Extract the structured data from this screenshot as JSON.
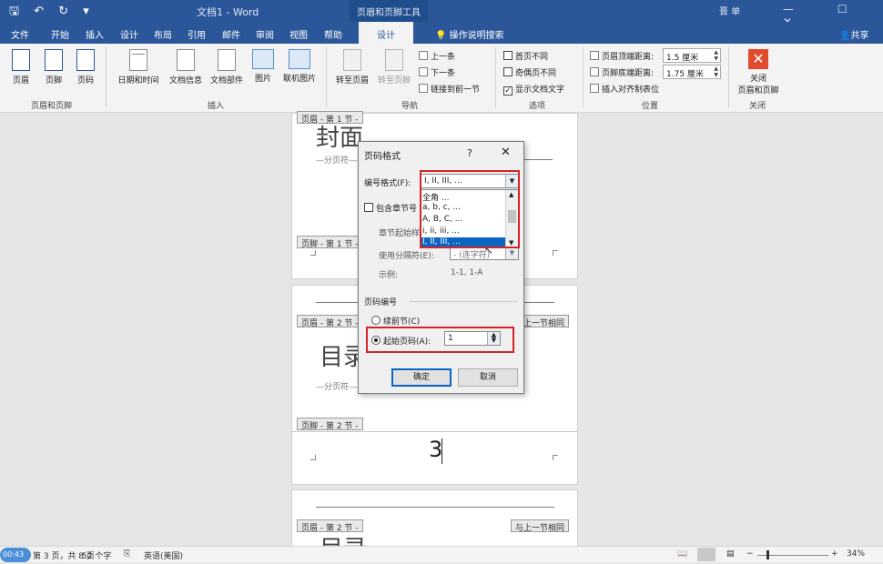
{
  "titlebar": {
    "quick_access": "🖫 ↶ ↻ ▾",
    "doc_title": "文档1 - Word",
    "context_tool": "页眉和页脚工具",
    "user": "晋 单",
    "window_controls": "— ☐ ✕"
  },
  "tabs": {
    "file": "文件",
    "home": "开始",
    "insert": "插入",
    "design_main": "设计",
    "layout": "布局",
    "references": "引用",
    "mailings": "邮件",
    "review": "审阅",
    "view": "视图",
    "help": "帮助",
    "design_ctx": "设计",
    "tell_me": "操作说明搜索",
    "share": "共享"
  },
  "ribbon": {
    "header": "页眉",
    "footer": "页脚",
    "page_number": "页码",
    "group_hf": "页眉和页脚",
    "date_time": "日期和时间",
    "doc_info": "文档信息",
    "quick_parts": "文档部件",
    "pictures": "图片",
    "online_pictures": "联机图片",
    "group_insert": "插入",
    "goto_header": "转至页眉",
    "goto_footer": "转至页脚",
    "previous": "上一条",
    "next": "下一条",
    "link_previous": "链接到前一节",
    "group_nav": "导航",
    "diff_first": "首页不同",
    "diff_odd_even": "奇偶页不同",
    "show_doc_text": "显示文档文字",
    "group_options": "选项",
    "header_top_label": "页眉顶端距离:",
    "header_top_value": "1.5 厘米",
    "footer_bottom_label": "页脚底端距离:",
    "footer_bottom_value": "1.75 厘米",
    "insert_align_tab": "插入对齐制表位",
    "group_position": "位置",
    "close_hf": "关闭",
    "close_hf2": "页眉和页脚",
    "group_close": "关闭"
  },
  "document": {
    "p1_header_tab": "页眉 - 第 1 节 -",
    "p1_title": "封面",
    "page_break": "分页符",
    "p1_footer_tab": "页脚 - 第 1 节 -",
    "p2_header_tab": "页眉 - 第 2 节 -",
    "same_as_previous": "与上一节相同",
    "p2_title": "目录",
    "p2_footer_tab": "页脚 - 第 2 节 -",
    "page_number_digit": "3",
    "p3_header_tab": "页眉 - 第 2 节 -",
    "p3_same_as_previous": "与上一节相同",
    "p3_title": "目录"
  },
  "dialog": {
    "title": "页码格式",
    "help": "?",
    "close": "✕",
    "number_format_label": "编号格式(F):",
    "number_format_value": "I, II, III, ...",
    "format_options": [
      "全角 ...",
      "a, b, c, ...",
      "A, B, C, ...",
      "i, ii, iii, ...",
      "I, II, III, ..."
    ],
    "include_chapter": "包含章节号",
    "chapter_start_style": "章节起始样",
    "use_separator": "使用分隔符(E):",
    "separator_value": "- (连字符)",
    "example_label": "示例:",
    "example_value": "1-1, 1-A",
    "page_numbering": "页码编号",
    "continue_previous": "续前节(C)",
    "start_at": "起始页码(A):",
    "start_at_value": "1",
    "ok": "确定",
    "cancel": "取消"
  },
  "statusbar": {
    "page_info": "第 3 页，共 8 页",
    "words": "52 个字",
    "language": "英语(美国)",
    "zoom": "34%",
    "timer": "00:43"
  },
  "colors": {
    "accent": "#2b579a",
    "highlight_red": "#d3242a",
    "selection": "#0a64c2"
  }
}
